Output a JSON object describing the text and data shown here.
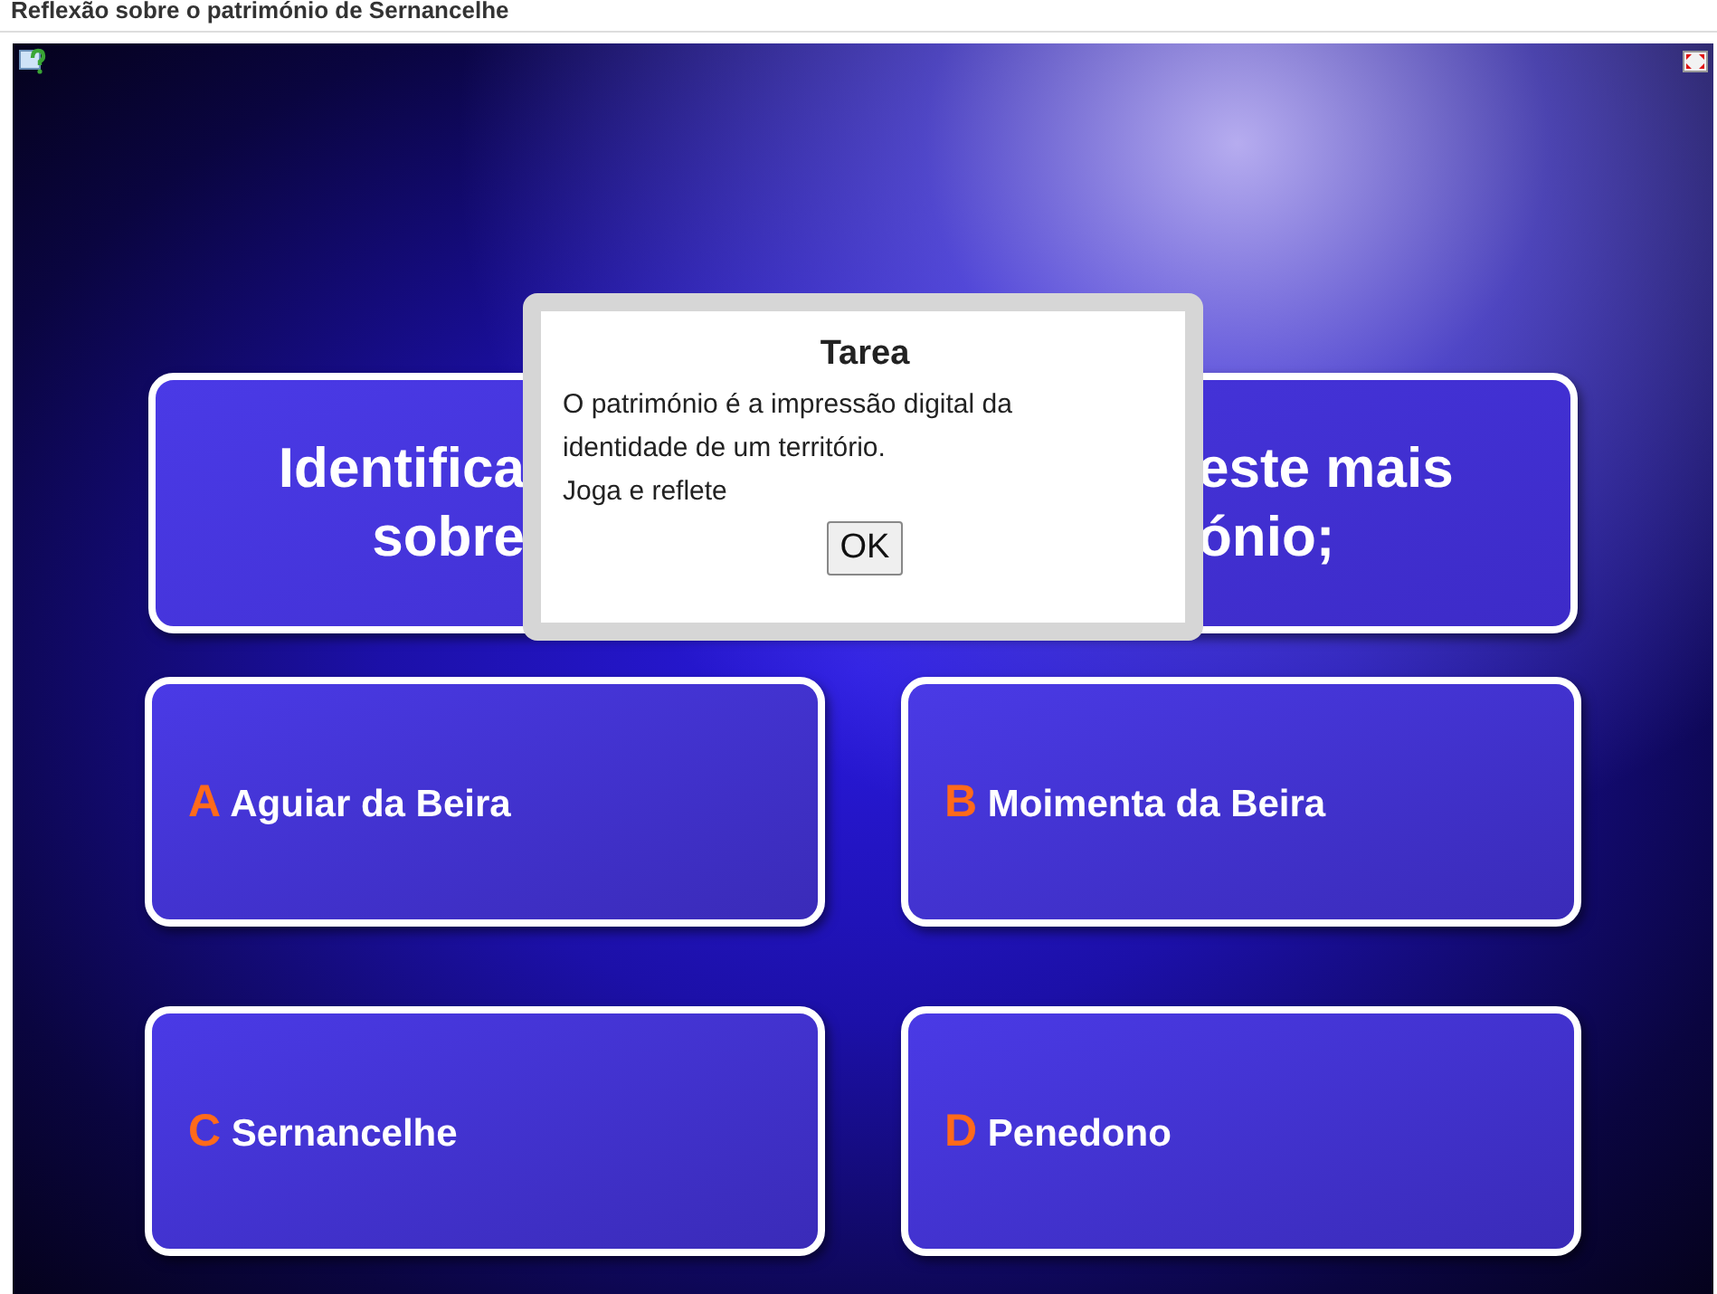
{
  "page_title": "Reflexão sobre o património de Sernancelhe",
  "question": {
    "lines": [
      {
        "left": "Identifica",
        "right": "este mais"
      },
      {
        "left": "sobre",
        "right": "ónio;"
      }
    ]
  },
  "answers": [
    {
      "letter": "A",
      "text": "Aguiar da Beira"
    },
    {
      "letter": "B",
      "text": "Moimenta da Beira"
    },
    {
      "letter": "C",
      "text": "Sernancelhe"
    },
    {
      "letter": "D",
      "text": "Penedono"
    }
  ],
  "dialog": {
    "title": "Tarea",
    "lines": [
      "O património é a impressão digital da identidade de um território.",
      "Joga e reflete"
    ],
    "button": "OK"
  }
}
